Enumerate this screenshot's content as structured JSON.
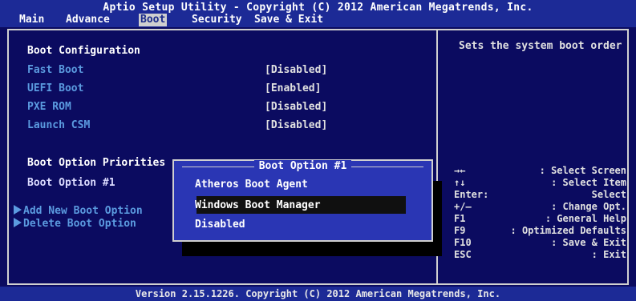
{
  "header": {
    "title": "Aptio Setup Utility - Copyright (C) 2012 American Megatrends, Inc.",
    "tabs": [
      {
        "label": "Main",
        "active": false
      },
      {
        "label": "Advance",
        "active": false
      },
      {
        "label": "Boot",
        "active": true
      },
      {
        "label": "Security",
        "active": false
      },
      {
        "label": "Save & Exit",
        "active": false
      }
    ]
  },
  "settings": {
    "boot_configuration": "Boot Configuration",
    "fast_boot": {
      "label": "Fast Boot",
      "value": "[Disabled]"
    },
    "uefi_boot": {
      "label": "UEFI Boot",
      "value": "[Enabled]"
    },
    "pxe_rom": {
      "label": "PXE ROM",
      "value": "[Disabled]"
    },
    "launch_csm": {
      "label": "Launch CSM",
      "value": "[Disabled]"
    },
    "boot_option_priorities": "Boot Option Priorities",
    "boot_option_1": "Boot Option #1",
    "add_new_boot_option": "Add New Boot Option",
    "delete_boot_option": "Delete Boot Option"
  },
  "popup": {
    "title": "Boot Option #1",
    "options": [
      "Atheros Boot Agent",
      "Windows Boot Manager",
      "Disabled"
    ],
    "selected_index": 1
  },
  "help": {
    "description": "Sets the system boot order",
    "keys": [
      {
        "key": "→←",
        "desc": ": Select Screen"
      },
      {
        "key": "↑↓",
        "desc": ": Select Item"
      },
      {
        "key": "Enter:",
        "desc": "Select"
      },
      {
        "key": "+/—",
        "desc": ": Change Opt."
      },
      {
        "key": "F1",
        "desc": ": General Help"
      },
      {
        "key": "F9",
        "desc": ": Optimized Defaults"
      },
      {
        "key": "F10",
        "desc": ": Save & Exit"
      },
      {
        "key": "ESC",
        "desc": ": Exit"
      }
    ]
  },
  "footer": "Version 2.15.1226. Copyright (C) 2012 American Megatrends, Inc.",
  "colors": {
    "background": "#0b0b60",
    "header": "#1c2a96",
    "label_blue": "#5b9be0",
    "popup": "#2a36b4"
  }
}
